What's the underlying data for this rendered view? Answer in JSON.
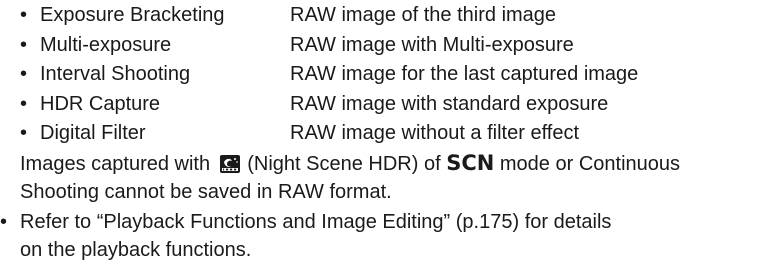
{
  "raw_list": {
    "items": [
      {
        "bullet": "•",
        "name": "Exposure Bracketing",
        "description": "RAW image of the third image"
      },
      {
        "bullet": "•",
        "name": "Multi-exposure",
        "description": "RAW image with Multi-exposure"
      },
      {
        "bullet": "•",
        "name": "Interval Shooting",
        "description": "RAW image for the last captured image"
      },
      {
        "bullet": "•",
        "name": "HDR Capture",
        "description": "RAW image with standard exposure"
      },
      {
        "bullet": "•",
        "name": "Digital Filter",
        "description": "RAW image without a filter effect"
      }
    ]
  },
  "note": {
    "part1": "Images captured with",
    "icon_name": "night-scene-hdr-icon",
    "part2": "(Night Scene HDR) of",
    "mode_label": "SCN",
    "part3": "mode or Continuous",
    "line2": "Shooting cannot be saved in RAW format."
  },
  "refer": {
    "bullet": "•",
    "line1": "Refer to “Playback Functions and Image Editing” (p.175) for details",
    "line2": "on the playback functions."
  }
}
